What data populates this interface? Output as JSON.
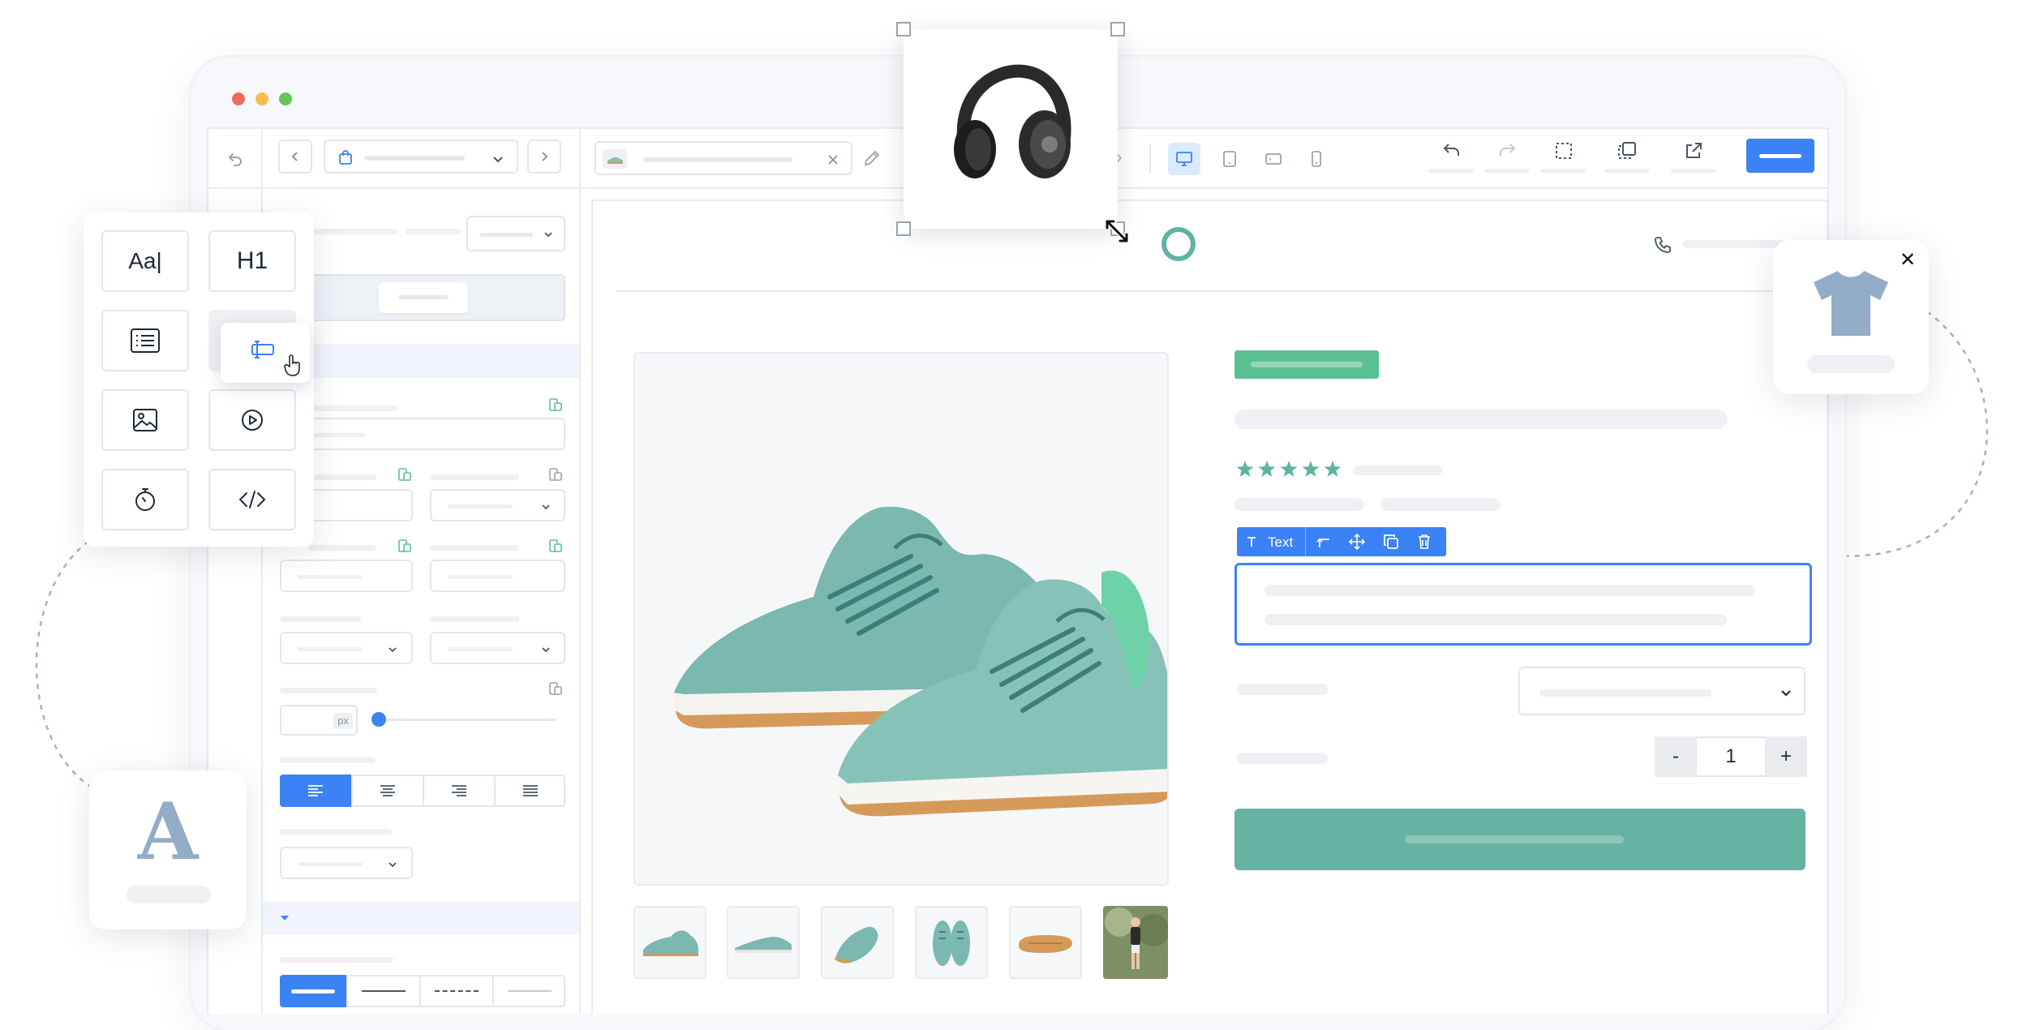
{
  "palette": {
    "accent_blue": "#3b82f6",
    "teal": "#5fb3a1",
    "green_badge": "#5cbf94",
    "window_bg": "#f7f8fb",
    "mac_red": "#ee6a5f",
    "mac_yellow": "#f5be4f",
    "mac_green": "#62c554"
  },
  "element_palette": {
    "tiles": [
      {
        "label": "Aa|",
        "icon": "text-icon"
      },
      {
        "label": "H1",
        "icon": "heading-icon"
      },
      {
        "label": "",
        "icon": "list-icon"
      },
      {
        "label": "",
        "icon": "button-icon"
      },
      {
        "label": "",
        "icon": "image-icon"
      },
      {
        "label": "",
        "icon": "video-icon"
      },
      {
        "label": "",
        "icon": "timer-icon"
      },
      {
        "label": "",
        "icon": "code-icon"
      }
    ]
  },
  "sidebar": {
    "size_unit": "px"
  },
  "text_toolbar": {
    "label": "Text",
    "icons": [
      "text-type-icon",
      "select-parent-icon",
      "move-icon",
      "duplicate-icon",
      "delete-icon"
    ]
  },
  "product": {
    "rating_stars": 5,
    "quantity": "1",
    "qty_minus": "-",
    "qty_plus": "+"
  },
  "font_card": {
    "glyph": "A"
  },
  "close_symbol": "✕",
  "device_icons": [
    "desktop-icon",
    "tablet-icon",
    "tablet-landscape-icon",
    "mobile-icon"
  ]
}
